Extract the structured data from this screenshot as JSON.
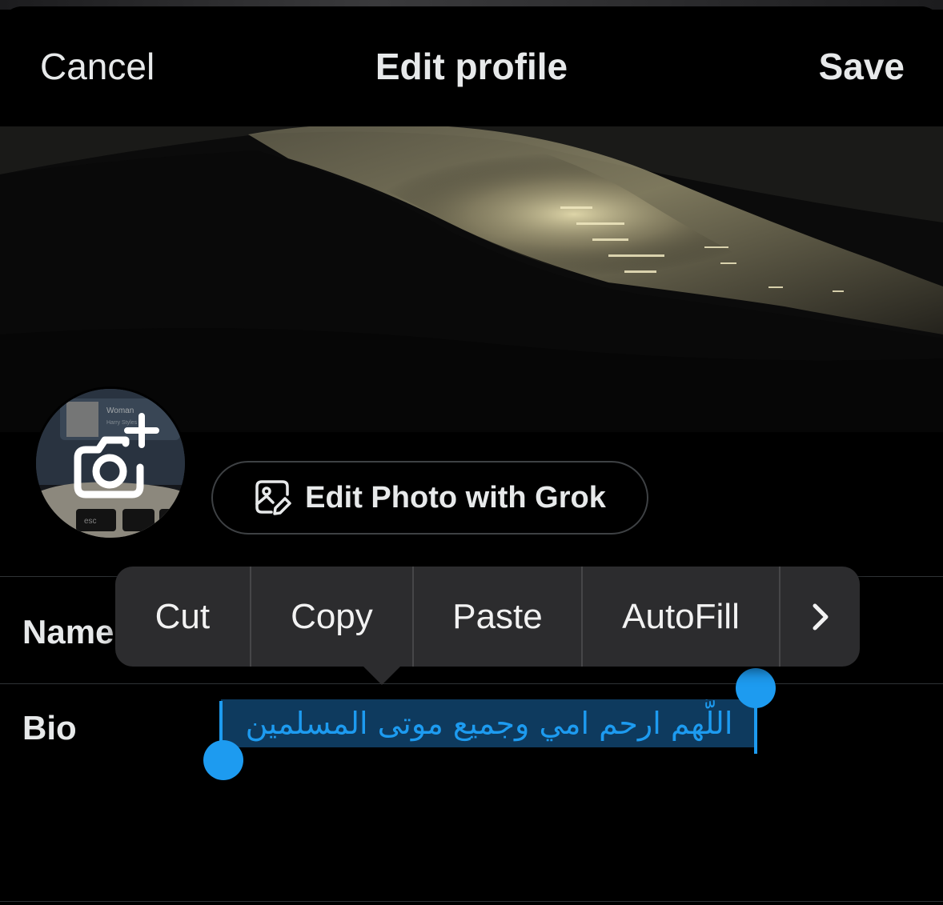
{
  "header": {
    "cancel_label": "Cancel",
    "title": "Edit profile",
    "save_label": "Save"
  },
  "avatar": {
    "thumb_title": "Woman",
    "thumb_artist": "Harry Styles",
    "key_label": "esc"
  },
  "grok_button": {
    "label": "Edit Photo with Grok",
    "icon": "image-edit-icon"
  },
  "fields": {
    "name_label": "Name",
    "bio_label": "Bio",
    "bio_value": "اللُّهم ارحم امي وجميع موتى المسلمين"
  },
  "context_menu": {
    "items": [
      "Cut",
      "Copy",
      "Paste",
      "AutoFill"
    ],
    "more_icon": "chevron-right-icon"
  },
  "colors": {
    "accent": "#1d9bf0",
    "menu_bg": "#2c2c2e",
    "background": "#000000"
  }
}
